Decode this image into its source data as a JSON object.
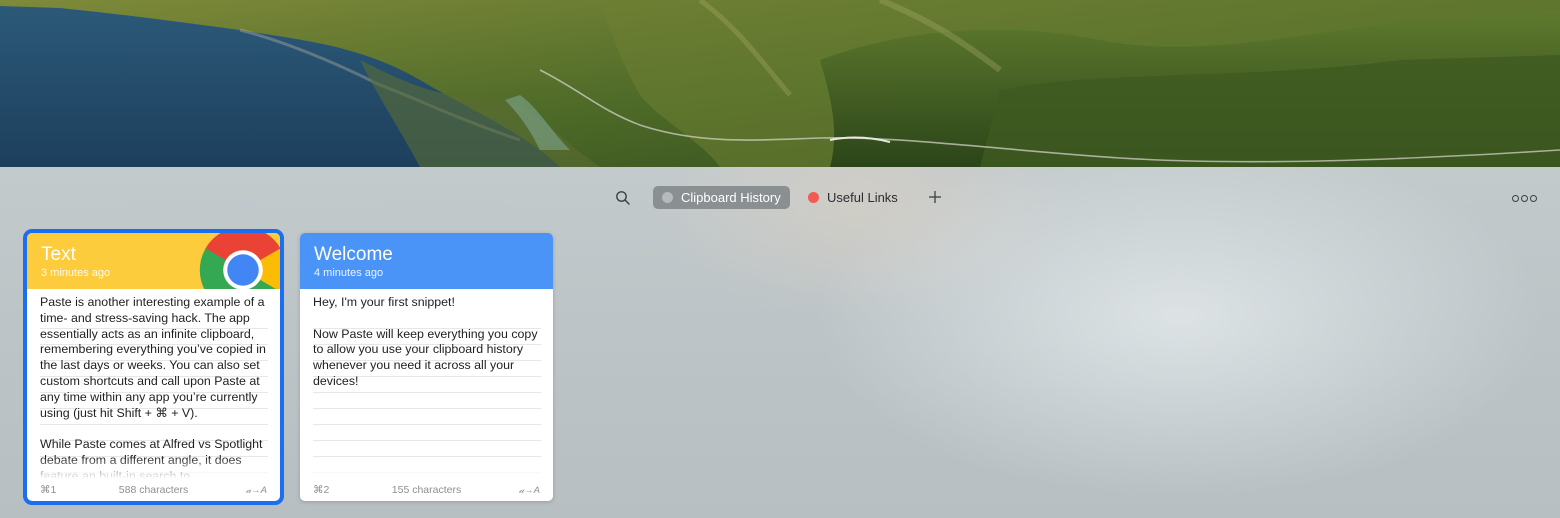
{
  "toolbar": {
    "search_icon": "search-icon",
    "pinboards": [
      {
        "label": "Clipboard History",
        "color": "#b7babc",
        "active": true
      },
      {
        "label": "Useful Links",
        "color": "#f15a55",
        "active": false
      }
    ],
    "add_icon": "plus-icon",
    "more_icon": "more-icon"
  },
  "cards": [
    {
      "type": "Text",
      "time": "3 minutes ago",
      "header_color": "#fdcc3c",
      "app_icon": "chrome-icon",
      "body": "Paste is another interesting example of a time- and stress-saving hack. The app essentially acts as an infinite clipboard, remembering everything you’ve copied in the last days or weeks. You can also set custom shortcuts and call upon Paste at any time within any app you’re currently using (just hit Shift + ⌘ + V).\n\nWhile Paste comes at Alfred vs Spotlight debate from a different angle, it does feature an built-in search to",
      "shortcut": "⌘1",
      "characters": "588 characters",
      "format": "𝒶→A",
      "selected": true
    },
    {
      "type": "Welcome",
      "time": "4 minutes ago",
      "header_color": "#4a93f7",
      "body": "Hey, I'm your first snippet!\n\nNow Paste will keep everything you copy to allow you use your clipboard history whenever you need it across all your devices!",
      "shortcut": "⌘2",
      "characters": "155 characters",
      "format": "𝒶→A",
      "selected": false
    }
  ]
}
